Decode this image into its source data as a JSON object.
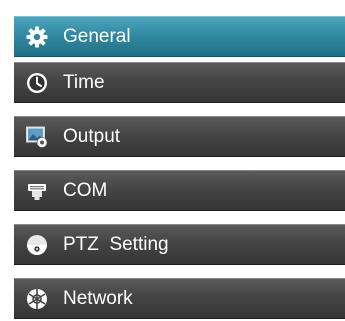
{
  "menu": {
    "items": [
      {
        "label": "General",
        "icon": "gear-icon",
        "active": true
      },
      {
        "label": "Time",
        "icon": "clock-icon",
        "active": false
      },
      {
        "label": "Output",
        "icon": "output-settings-icon",
        "active": false
      },
      {
        "label": "COM",
        "icon": "com-port-icon",
        "active": false
      },
      {
        "label": "PTZ  Setting",
        "icon": "ptz-camera-icon",
        "active": false
      },
      {
        "label": "Network",
        "icon": "network-globe-icon",
        "active": false
      }
    ]
  },
  "colors": {
    "active_bg": "#2f88a0",
    "item_bg": "#454545",
    "text": "#ffffff"
  }
}
